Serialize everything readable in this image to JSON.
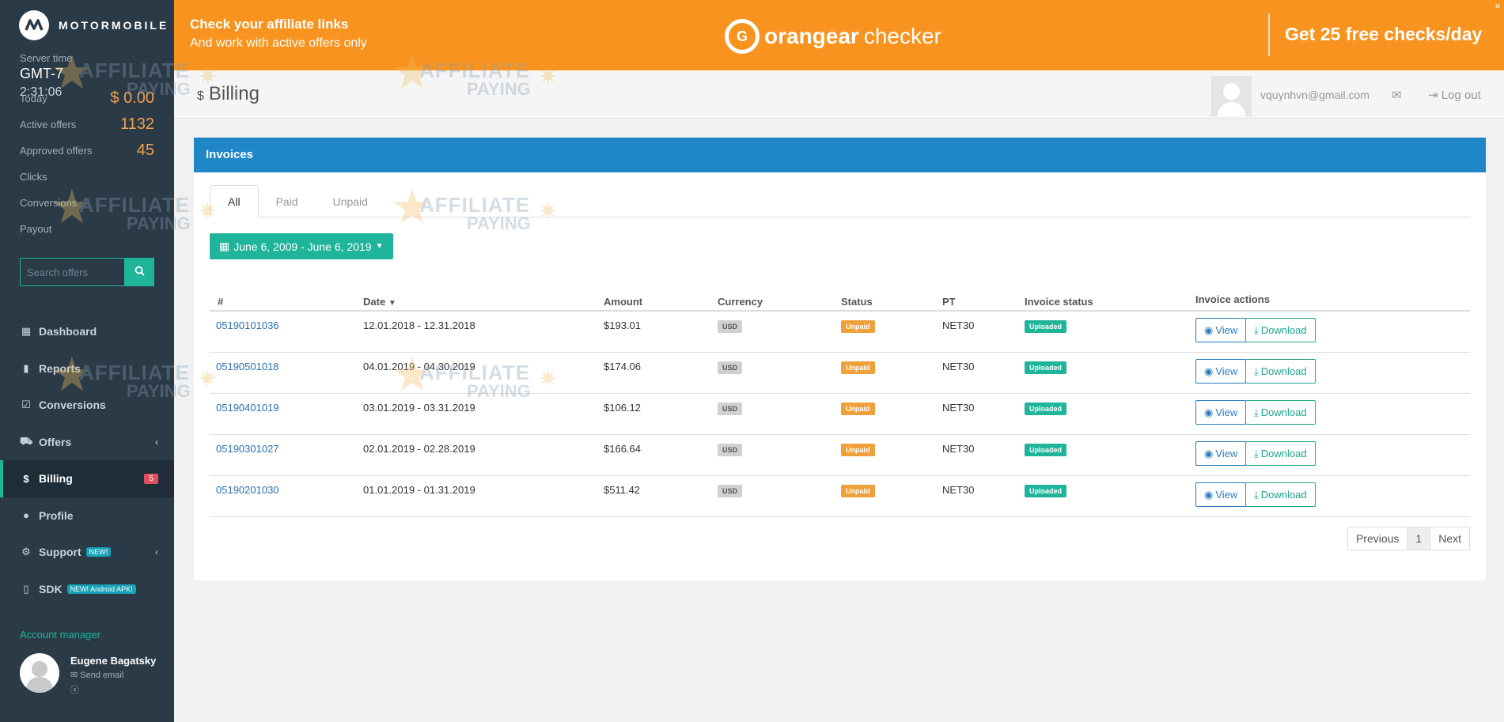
{
  "sidebar": {
    "logo_text": "MOTORMOBILE",
    "server_time_label": "Server time",
    "timezone": "GMT-7",
    "server_time": "2:31:06",
    "stats": [
      {
        "label": "Today",
        "value": "$ 0.00"
      },
      {
        "label": "Active offers",
        "value": "1132"
      },
      {
        "label": "Approved offers",
        "value": "45"
      },
      {
        "label": "Clicks",
        "value": ""
      },
      {
        "label": "Conversions",
        "value": ""
      },
      {
        "label": "Payout",
        "value": ""
      }
    ],
    "search_placeholder": "Search offers",
    "nav": [
      {
        "label": "Dashboard",
        "icon": "dashboard-icon"
      },
      {
        "label": "Reports",
        "icon": "bar-chart-icon"
      },
      {
        "label": "Conversions",
        "icon": "checkbox-icon"
      },
      {
        "label": "Offers",
        "icon": "cart-icon"
      },
      {
        "label": "Billing",
        "icon": "dollar-icon",
        "badge": "5"
      },
      {
        "label": "Profile",
        "icon": "user-icon"
      },
      {
        "label": "Support",
        "icon": "gears-icon",
        "badge": "NEW!"
      },
      {
        "label": "SDK",
        "icon": "mobile-icon",
        "badge": "NEW! Android APK!"
      }
    ],
    "account_manager_label": "Account manager",
    "manager_name": "Eugene Bagatsky",
    "send_email": "Send email"
  },
  "banner": {
    "line1": "Check your affiliate links",
    "line2": "And work with active offers only",
    "brand_bold": "orangear",
    "brand_light": "checker",
    "cta": "Get 25 free checks/day",
    "close": "×"
  },
  "header": {
    "title": "Billing",
    "title_icon": "$",
    "email": "vquynhvn@gmail.com",
    "logout": "Log out"
  },
  "invoices": {
    "panel_title": "Invoices",
    "tabs": [
      "All",
      "Paid",
      "Unpaid"
    ],
    "active_tab": "All",
    "date_range": "June 6, 2009 - June 6, 2019",
    "columns": [
      "#",
      "Date",
      "Amount",
      "Currency",
      "Status",
      "PT",
      "Invoice status",
      "Invoice actions"
    ],
    "rows": [
      {
        "id": "05190101036",
        "date": "12.01.2018 - 12.31.2018",
        "amount": "$193.01",
        "currency": "USD",
        "status": "Unpaid",
        "pt": "NET30",
        "invoice_status": "Uploaded"
      },
      {
        "id": "05190501018",
        "date": "04.01.2019 - 04.30.2019",
        "amount": "$174.06",
        "currency": "USD",
        "status": "Unpaid",
        "pt": "NET30",
        "invoice_status": "Uploaded"
      },
      {
        "id": "05190401019",
        "date": "03.01.2019 - 03.31.2019",
        "amount": "$106.12",
        "currency": "USD",
        "status": "Unpaid",
        "pt": "NET30",
        "invoice_status": "Uploaded"
      },
      {
        "id": "05190301027",
        "date": "02.01.2019 - 02.28.2019",
        "amount": "$166.64",
        "currency": "USD",
        "status": "Unpaid",
        "pt": "NET30",
        "invoice_status": "Uploaded"
      },
      {
        "id": "05190201030",
        "date": "01.01.2019 - 01.31.2019",
        "amount": "$511.42",
        "currency": "USD",
        "status": "Unpaid",
        "pt": "NET30",
        "invoice_status": "Uploaded"
      }
    ],
    "view_label": "View",
    "download_label": "Download",
    "pager": {
      "previous": "Previous",
      "current": "1",
      "next": "Next"
    }
  },
  "watermark": {
    "line1": "AFFILIATE",
    "line2": "PAYING"
  },
  "colors": {
    "accent": "#1fb59a",
    "banner": "#f7931e",
    "panel_head": "#1f87c7",
    "sidebar": "#2a3a47",
    "unpaid": "#f0a03a"
  }
}
